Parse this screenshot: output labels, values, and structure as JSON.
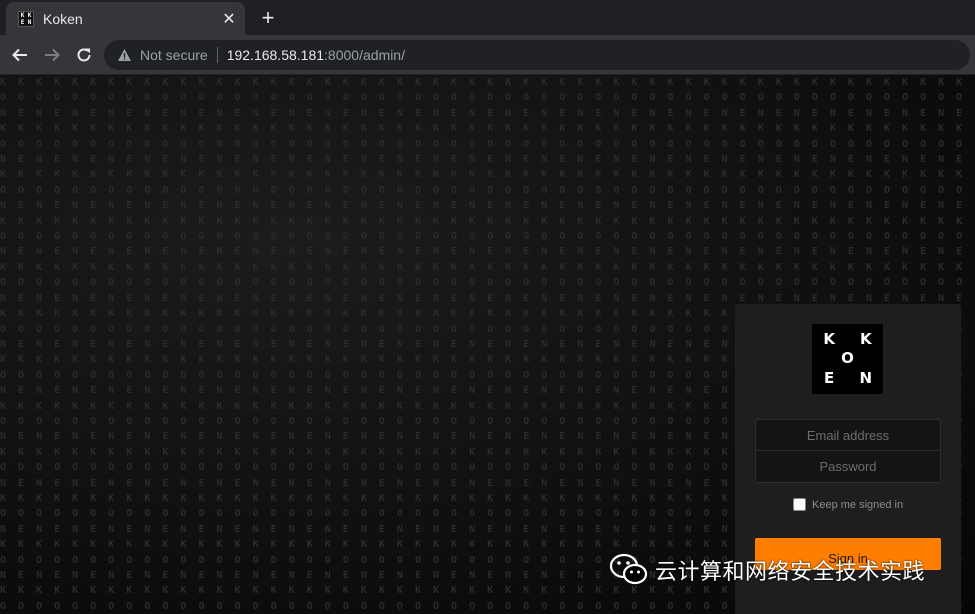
{
  "browser": {
    "tab_title": "Koken",
    "favicon_letters": [
      "K",
      "K",
      "E",
      "N"
    ],
    "new_tab_symbol": "+",
    "close_symbol": "✕",
    "security_label": "Not secure",
    "url_host": "192.168.58.181",
    "url_rest": ":8000/admin/"
  },
  "login": {
    "logo_letters": [
      "K",
      "",
      "K",
      "",
      "O",
      "",
      "E",
      "",
      "N"
    ],
    "email_placeholder": "Email address",
    "password_placeholder": "Password",
    "keep_signed_in_label": "Keep me signed in",
    "keep_signed_in_checked": false,
    "sign_in_label": "Sign in",
    "accent_color": "#ff7e00"
  },
  "watermark": {
    "text": "云计算和网络安全技术实践",
    "icon": "wechat-icon"
  }
}
